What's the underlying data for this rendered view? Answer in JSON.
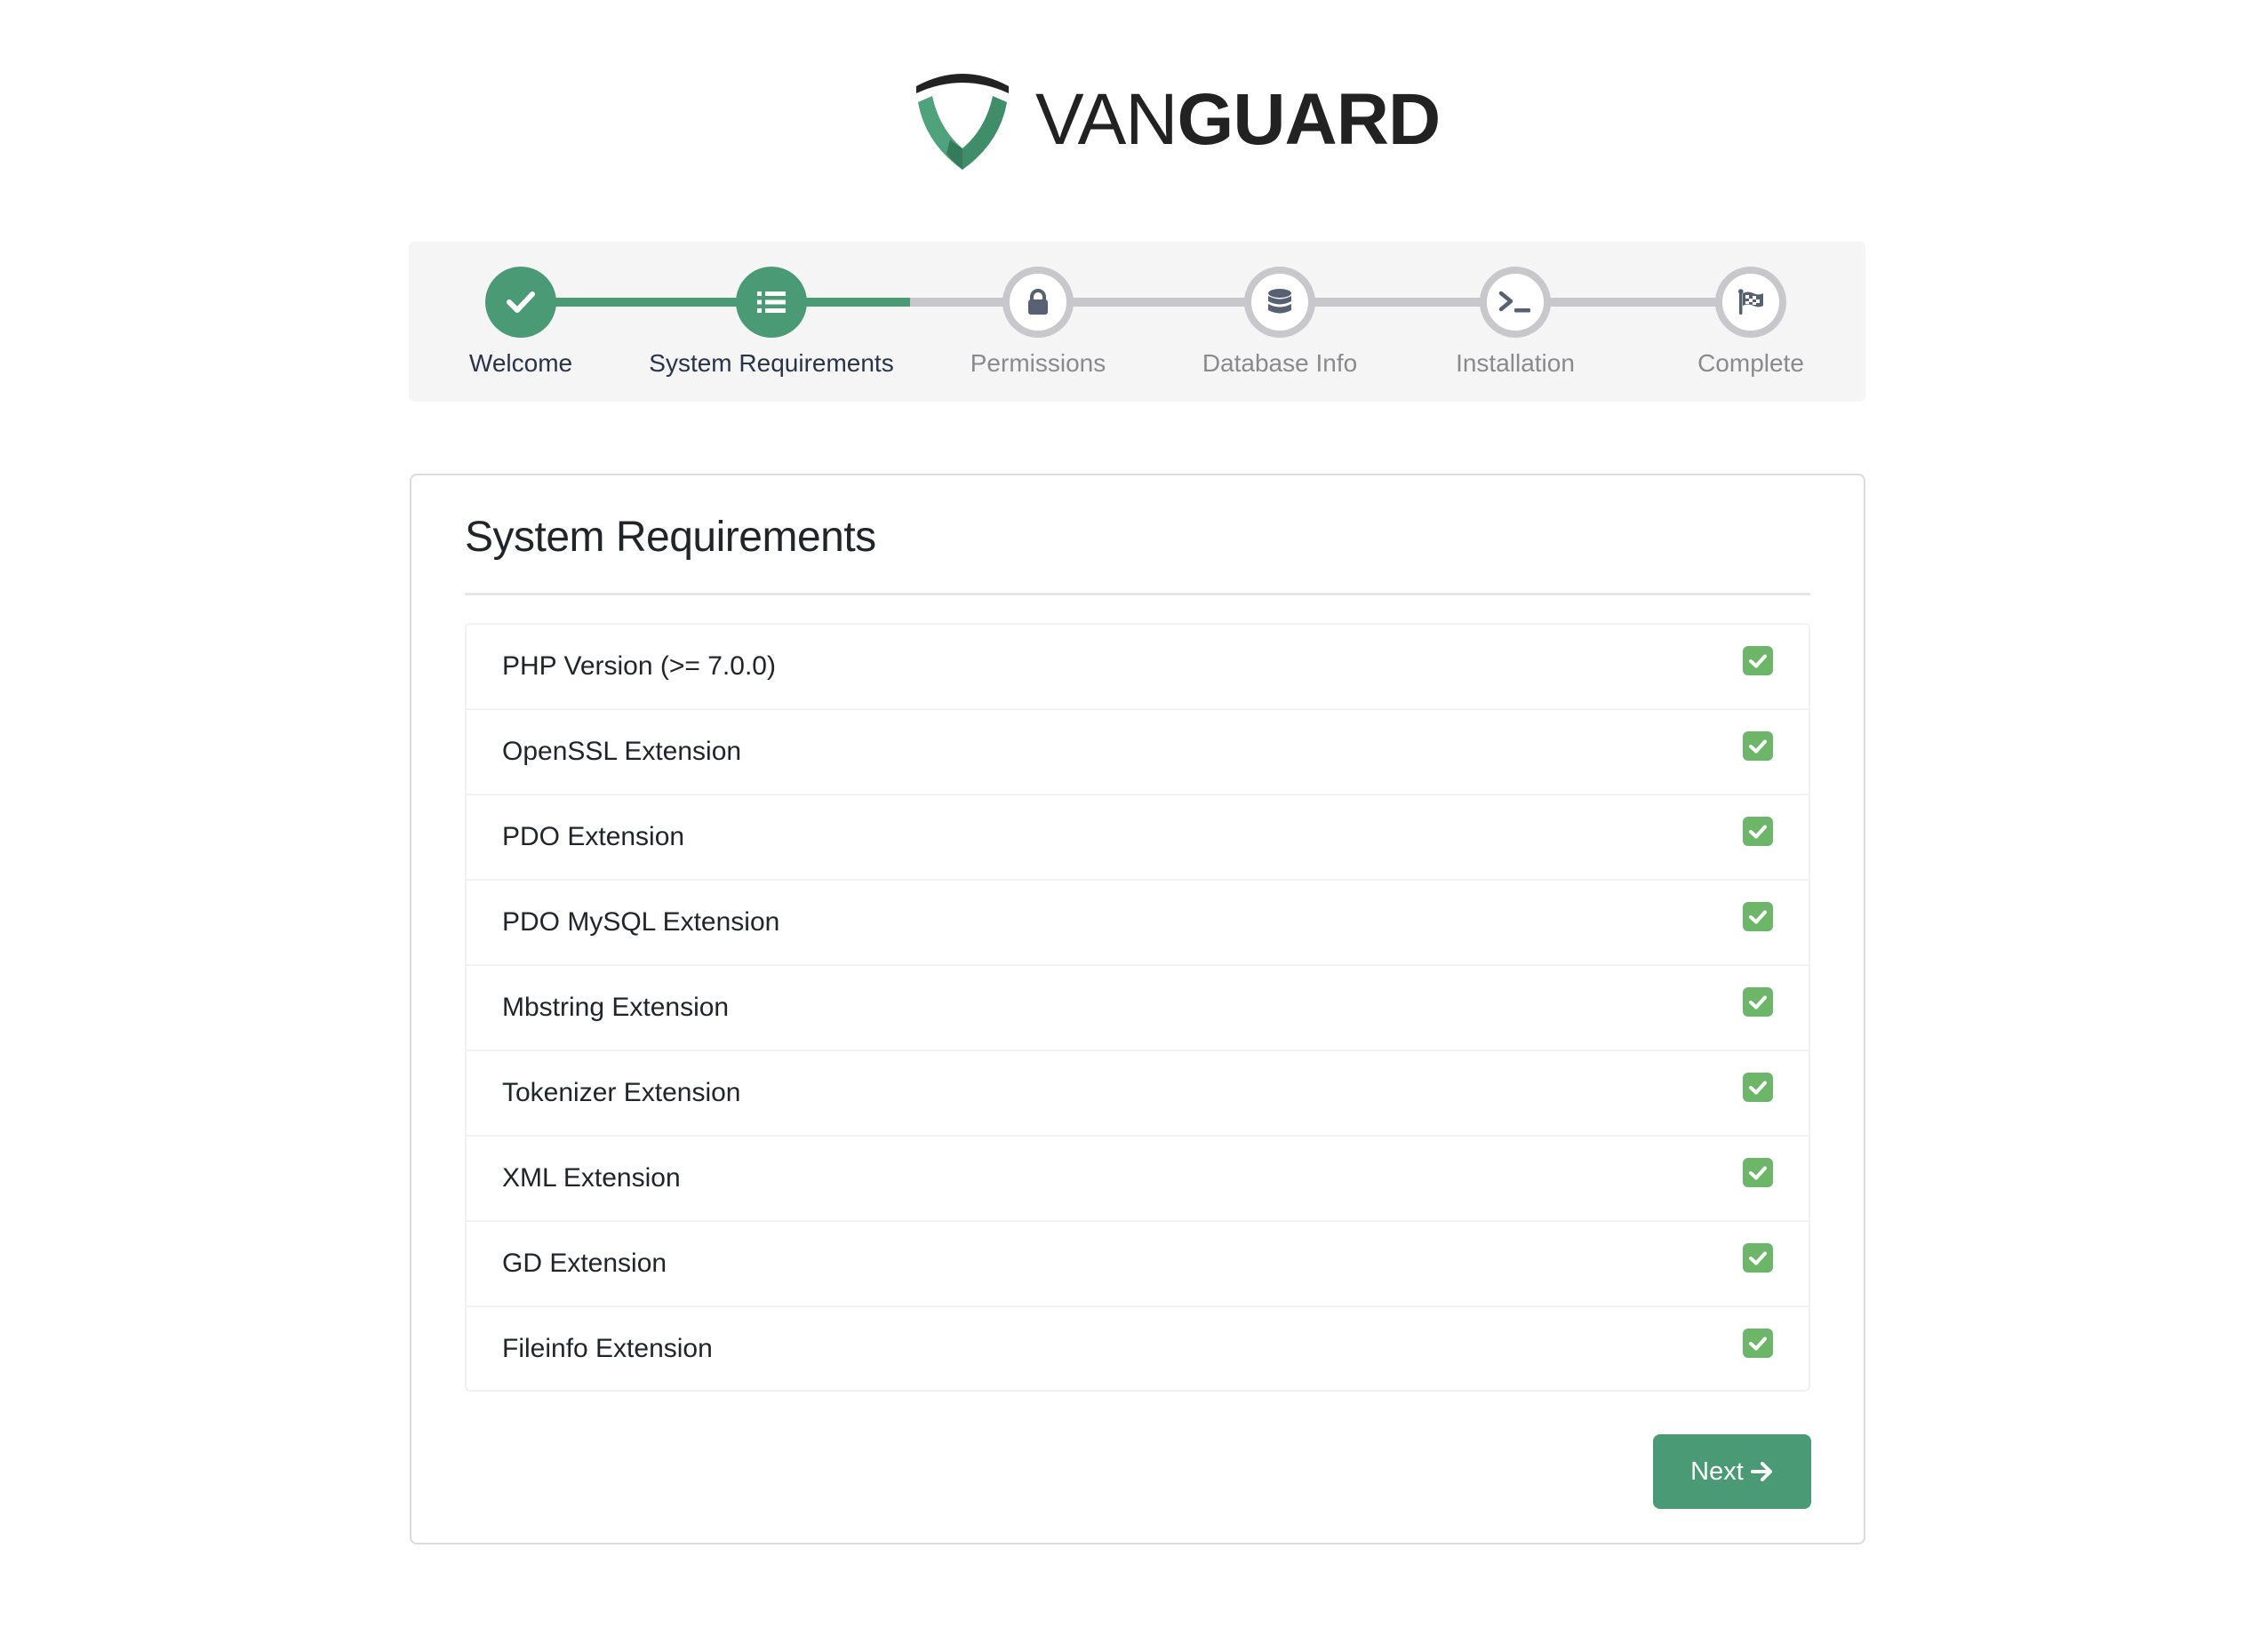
{
  "brand": {
    "name_light": "VAN",
    "name_bold": "GUARD",
    "icon": "shield-v-logo-icon",
    "colors": {
      "green": "#4a9a76",
      "dark": "#222222"
    }
  },
  "stepper": {
    "steps": [
      {
        "label": "Welcome",
        "icon": "check-icon",
        "state": "done"
      },
      {
        "label": "System Requirements",
        "icon": "list-icon",
        "state": "current"
      },
      {
        "label": "Permissions",
        "icon": "lock-icon",
        "state": "pending"
      },
      {
        "label": "Database Info",
        "icon": "database-icon",
        "state": "pending"
      },
      {
        "label": "Installation",
        "icon": "terminal-icon",
        "state": "pending"
      },
      {
        "label": "Complete",
        "icon": "checkered-flag-icon",
        "state": "pending"
      }
    ],
    "colors": {
      "active": "#4a9a76",
      "inactive": "#c8c8cc",
      "icon_inactive": "#566173"
    }
  },
  "card": {
    "title": "System Requirements",
    "requirements": [
      {
        "name": "PHP Version (>= 7.0.0)",
        "met": true
      },
      {
        "name": "OpenSSL Extension",
        "met": true
      },
      {
        "name": "PDO Extension",
        "met": true
      },
      {
        "name": "PDO MySQL Extension",
        "met": true
      },
      {
        "name": "Mbstring Extension",
        "met": true
      },
      {
        "name": "Tokenizer Extension",
        "met": true
      },
      {
        "name": "XML Extension",
        "met": true
      },
      {
        "name": "GD Extension",
        "met": true
      },
      {
        "name": "Fileinfo Extension",
        "met": true
      }
    ],
    "check_color": "#6cb66a",
    "next_label": "Next",
    "next_icon": "arrow-right-icon"
  }
}
